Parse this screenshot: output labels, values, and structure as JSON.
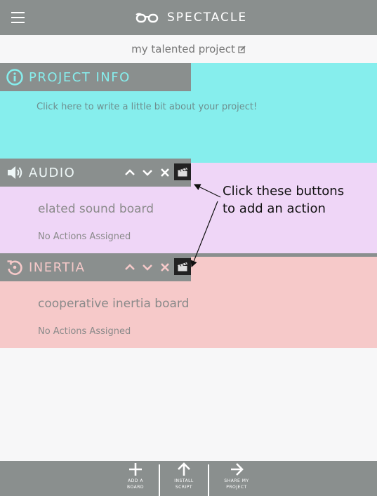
{
  "app": {
    "brand": "SPECTACLE",
    "menu_icon": "hamburger-icon",
    "logo_icon": "glasses-icon"
  },
  "project": {
    "name": "my talented project",
    "edit_icon": "edit-icon"
  },
  "info": {
    "title": "PROJECT INFO",
    "description": "Click here to write a little bit about your project!",
    "icon": "info-icon"
  },
  "boards": [
    {
      "title": "AUDIO",
      "name": "elated sound board",
      "actions": "No Actions Assigned",
      "icon": "speaker-icon",
      "color": "#efd6f7"
    },
    {
      "title": "INERTIA",
      "name": "cooperative inertia board",
      "actions": "No Actions Assigned",
      "icon": "rotate-icon",
      "color": "#f6c9c9"
    }
  ],
  "annotation": {
    "line1": "Click these buttons",
    "line2": "to add an action"
  },
  "bottom": {
    "add": {
      "line1": "ADD A",
      "line2": "BOARD"
    },
    "install": {
      "line1": "INSTALL",
      "line2": "SCRIPT"
    },
    "share": {
      "line1": "SHARE MY",
      "line2": "PROJECT"
    }
  },
  "colors": {
    "bar": "#8a8f8e",
    "info": "#86eeed",
    "audio": "#efd6f7",
    "inertia": "#f6c9c9"
  }
}
